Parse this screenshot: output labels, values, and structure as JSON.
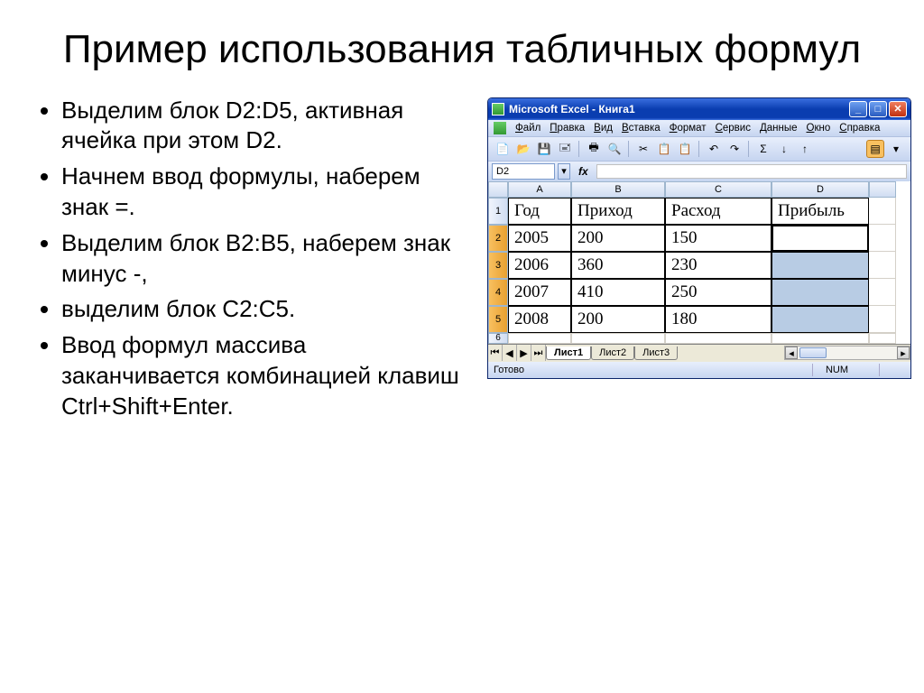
{
  "slide": {
    "title": "Пример использования табличных формул",
    "bullets": [
      "Выделим блок D2:D5, активная ячейка при этом D2.",
      "Начнем ввод формулы, наберем знак =.",
      "Выделим блок B2:B5, наберем знак минус -,",
      "выделим блок C2:C5.",
      "Ввод формул массива заканчивается комбинацией клавиш Ctrl+Shift+Enter."
    ]
  },
  "excel": {
    "title": "Microsoft Excel - Книга1",
    "menu": [
      "Файл",
      "Правка",
      "Вид",
      "Вставка",
      "Формат",
      "Сервис",
      "Данные",
      "Окно",
      "Справка"
    ],
    "namebox": "D2",
    "columns": [
      "A",
      "B",
      "C",
      "D"
    ],
    "rows": [
      "1",
      "2",
      "3",
      "4",
      "5",
      "6"
    ],
    "headers": {
      "a": "Год",
      "b": "Приход",
      "c": "Расход",
      "d": "Прибыль"
    },
    "data": [
      {
        "a": "2005",
        "b": "200",
        "c": "150"
      },
      {
        "a": "2006",
        "b": "360",
        "c": "230"
      },
      {
        "a": "2007",
        "b": "410",
        "c": "250"
      },
      {
        "a": "2008",
        "b": "200",
        "c": "180"
      }
    ],
    "tabs": [
      "Лист1",
      "Лист2",
      "Лист3"
    ],
    "status": {
      "ready": "Готово",
      "num": "NUM"
    }
  }
}
